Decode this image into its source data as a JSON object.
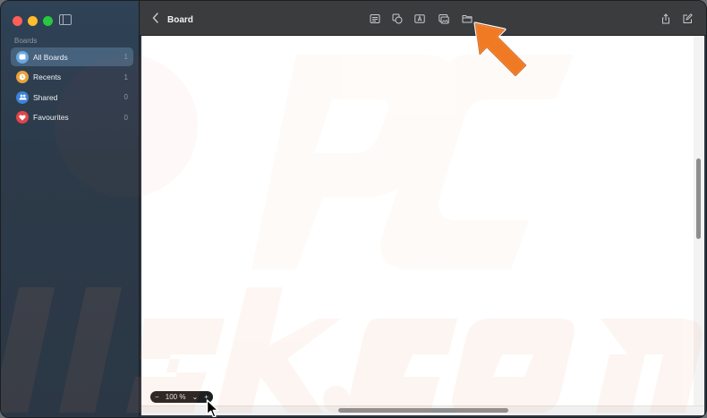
{
  "sidebar": {
    "section_label": "Boards",
    "items": [
      {
        "label": "All Boards",
        "count": "1",
        "icon": "boards-icon",
        "color": "#6aa6e0",
        "active": true
      },
      {
        "label": "Recents",
        "count": "1",
        "icon": "clock-icon",
        "color": "#e8a23a"
      },
      {
        "label": "Shared",
        "count": "0",
        "icon": "people-icon",
        "color": "#3b82d9"
      },
      {
        "label": "Favourites",
        "count": "0",
        "icon": "heart-icon",
        "color": "#e0454a"
      }
    ]
  },
  "toolbar": {
    "title": "Board",
    "icons": [
      "text-box-icon",
      "shapes-icon",
      "text-icon",
      "media-icon",
      "folder-icon"
    ],
    "right_icons": [
      "share-icon",
      "compose-icon"
    ]
  },
  "zoom": {
    "minus": "−",
    "value": "100 %",
    "chevron": "⌄",
    "plus": "+"
  },
  "colors": {
    "accent_arrow": "#f07a24",
    "sidebar_active": "#47627d"
  }
}
